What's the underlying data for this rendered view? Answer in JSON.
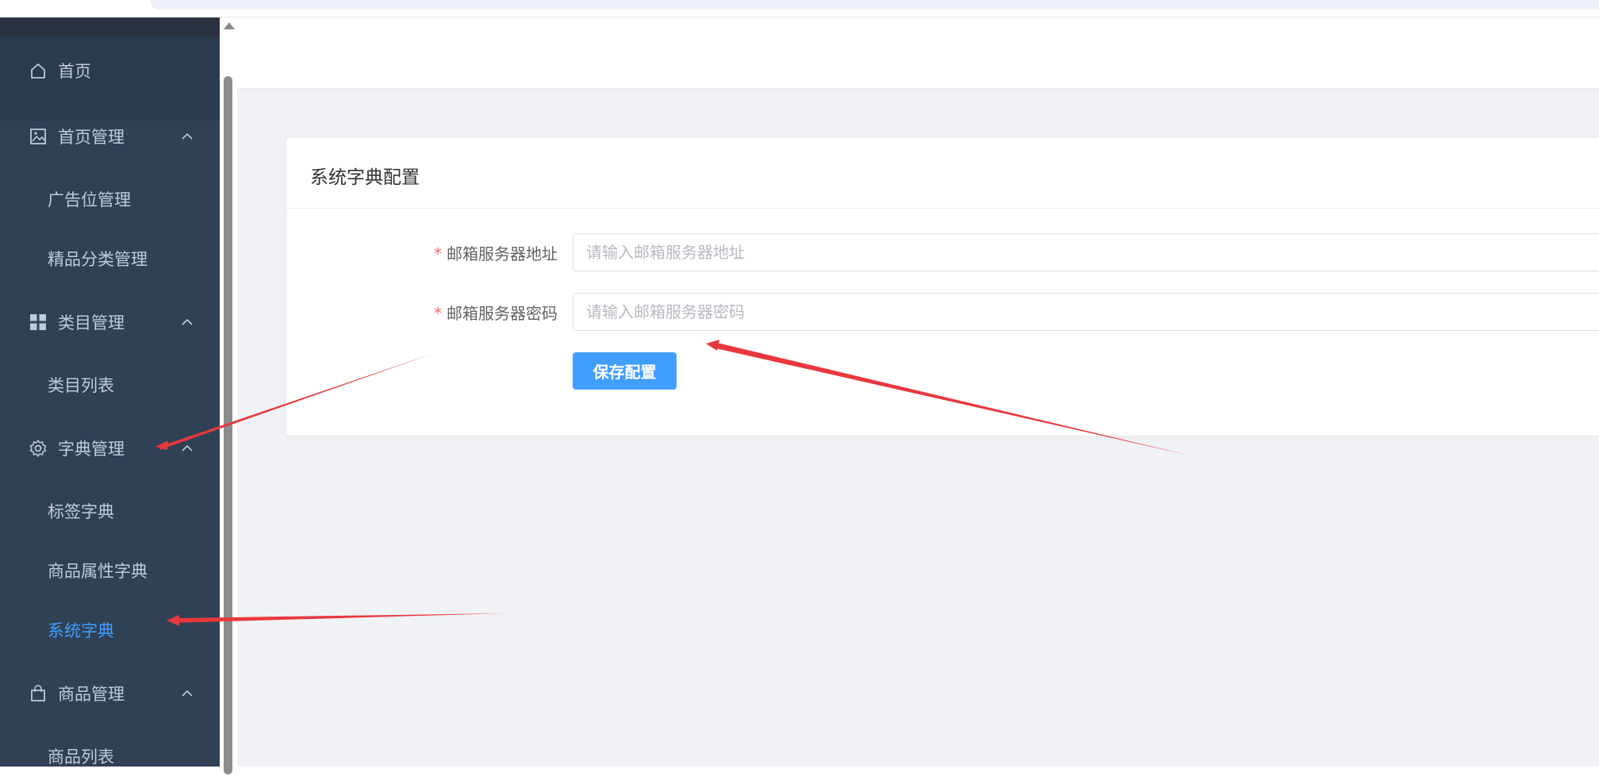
{
  "sidebar": {
    "items": [
      {
        "label": "首页",
        "icon": "home-icon"
      },
      {
        "label": "首页管理",
        "icon": "picture-icon",
        "children": [
          "广告位管理",
          "精品分类管理"
        ]
      },
      {
        "label": "类目管理",
        "icon": "grid-icon",
        "children": [
          "类目列表"
        ]
      },
      {
        "label": "字典管理",
        "icon": "gear-icon",
        "children": [
          "标签字典",
          "商品属性字典",
          "系统字典"
        ]
      },
      {
        "label": "商品管理",
        "icon": "bag-icon",
        "children": [
          "商品列表"
        ]
      }
    ],
    "active": "系统字典"
  },
  "card": {
    "title": "系统字典配置",
    "fields": [
      {
        "label": "邮箱服务器地址",
        "placeholder": "请输入邮箱服务器地址",
        "value": ""
      },
      {
        "label": "邮箱服务器密码",
        "placeholder": "请输入邮箱服务器密码",
        "value": ""
      }
    ],
    "required_mark": "*",
    "save_label": "保存配置"
  },
  "colors": {
    "sidebar_bg": "#304156",
    "sidebar_text": "#bfcbd9",
    "active": "#409eff",
    "primary_button": "#409eff",
    "required": "#f56c6c",
    "annotation_arrow": "#e8383d",
    "page_bg": "#f0f2f5"
  }
}
